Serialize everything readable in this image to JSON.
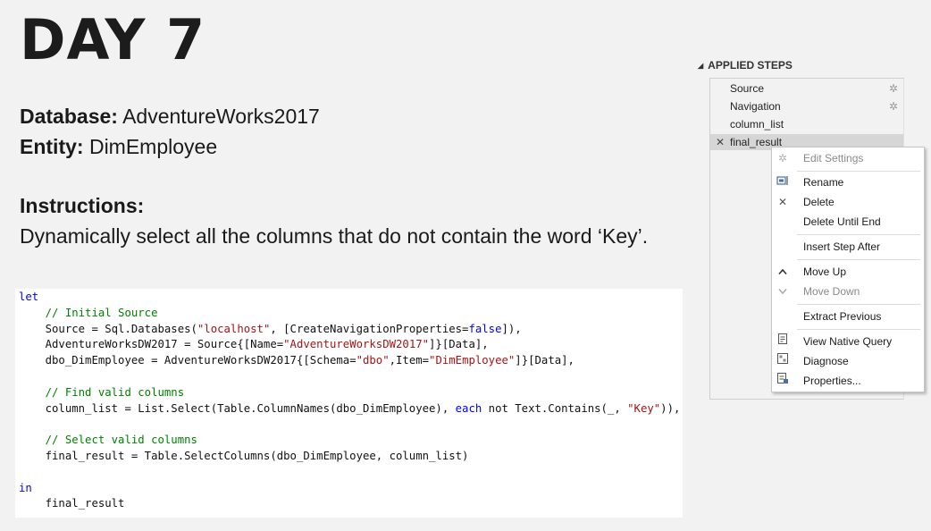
{
  "title": "DAY 7",
  "info": {
    "database_label": "Database:",
    "database_value": "AdventureWorks2017",
    "entity_label": "Entity:",
    "entity_value": "DimEmployee"
  },
  "instructions": {
    "heading": "Instructions:",
    "text": "Dynamically select all the columns that do not contain the word ‘Key’."
  },
  "code": {
    "kw_let": "let",
    "c1": "// Initial Source",
    "l2a": "Source = Sql.Databases(",
    "l2b": "\"localhost\"",
    "l2c": ", [CreateNavigationProperties=",
    "l2d": "false",
    "l2e": "]),",
    "l3a": "AdventureWorksDW2017 = Source{[Name=",
    "l3b": "\"AdventureWorksDW2017\"",
    "l3c": "]}[Data],",
    "l4a": "dbo_DimEmployee = AdventureWorksDW2017{[Schema=",
    "l4b": "\"dbo\"",
    "l4c": ",Item=",
    "l4d": "\"DimEmployee\"",
    "l4e": "]}[Data],",
    "c2": "// Find valid columns",
    "l6a": "column_list = List.Select(Table.ColumnNames(dbo_DimEmployee), ",
    "l6b": "each",
    "l6c": " not Text.Contains(_, ",
    "l6d": "\"Key\"",
    "l6e": ")),",
    "c3": "// Select valid columns",
    "l8": "final_result = Table.SelectColumns(dbo_DimEmployee, column_list)",
    "kw_in": "in",
    "l10": "final_result"
  },
  "applied_steps": {
    "heading": "APPLIED STEPS",
    "steps": [
      {
        "label": "Source",
        "has_gear": true
      },
      {
        "label": "Navigation",
        "has_gear": true
      },
      {
        "label": "column_list",
        "has_gear": false
      },
      {
        "label": "final_result",
        "has_gear": false,
        "selected": true
      }
    ]
  },
  "context_menu": {
    "items": [
      {
        "label": "Edit Settings",
        "icon": "gear-icon",
        "disabled": true
      },
      {
        "label": "Rename",
        "icon": "rename-icon",
        "disabled": false
      },
      {
        "label": "Delete",
        "icon": "close-icon",
        "disabled": false
      },
      {
        "label": "Delete Until End",
        "icon": "",
        "disabled": false
      },
      {
        "label": "Insert Step After",
        "icon": "",
        "disabled": false
      },
      {
        "label": "Move Up",
        "icon": "chevron-up-icon",
        "disabled": false
      },
      {
        "label": "Move Down",
        "icon": "chevron-down-icon",
        "disabled": true
      },
      {
        "label": "Extract Previous",
        "icon": "",
        "disabled": false
      },
      {
        "label": "View Native Query",
        "icon": "native-query-icon",
        "disabled": false
      },
      {
        "label": "Diagnose",
        "icon": "diagnose-icon",
        "disabled": false
      },
      {
        "label": "Properties...",
        "icon": "properties-icon",
        "disabled": false
      }
    ]
  },
  "colors": {
    "keyword": "#0000ff",
    "comment": "#008000",
    "string": "#a31515",
    "selected_step": "#d6d6d6"
  }
}
